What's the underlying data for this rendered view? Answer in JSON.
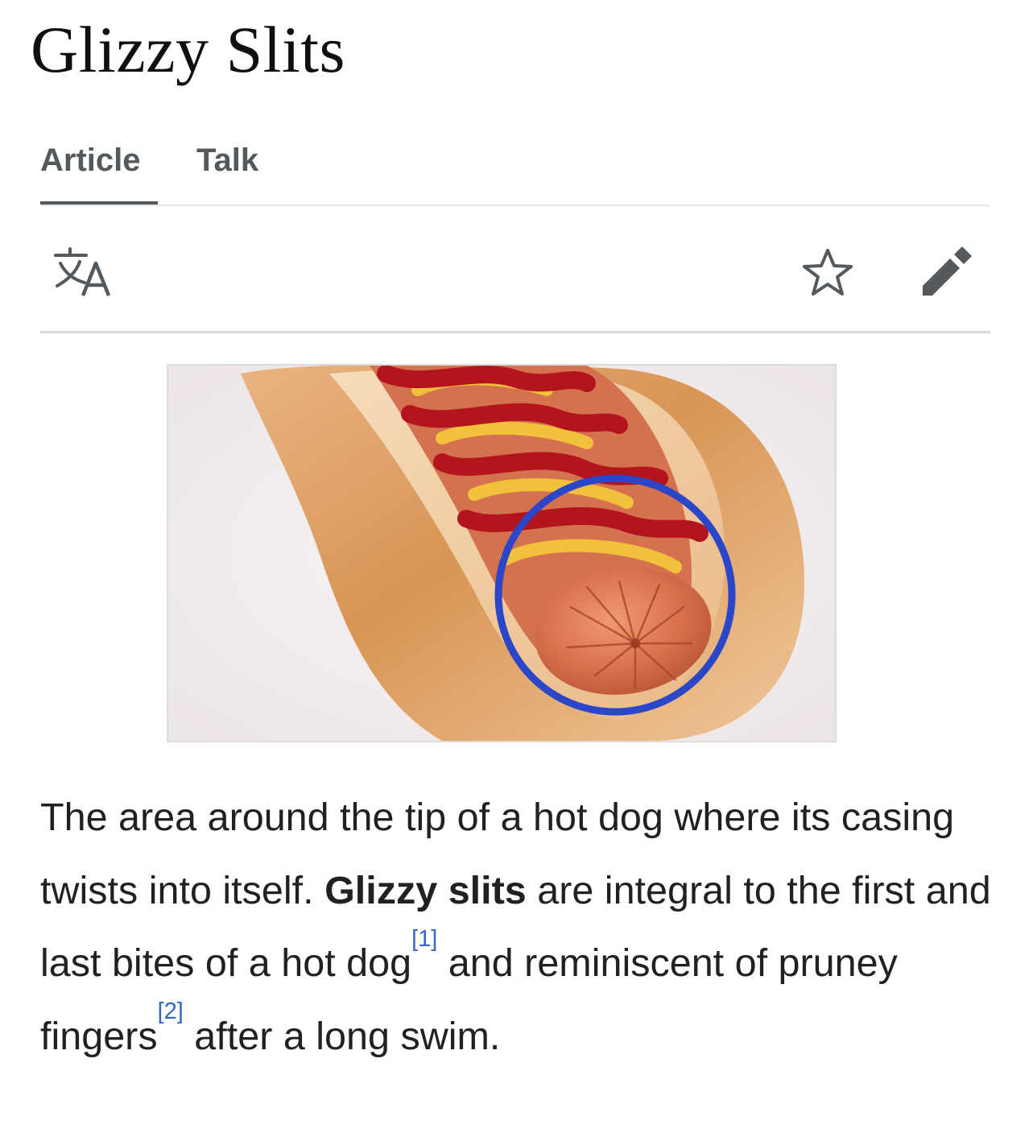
{
  "article": {
    "title": "Glizzy Slits"
  },
  "tabs": [
    {
      "label": "Article",
      "selected": true
    },
    {
      "label": "Talk",
      "selected": false
    }
  ],
  "toolbar": {
    "language_icon": "translate-icon",
    "watch_icon": "star-icon",
    "edit_icon": "pencil-icon"
  },
  "figure": {
    "description_icon": "hot-dog-photo",
    "highlight_color": "#2b46c9"
  },
  "content": {
    "part1": "The area around the tip of a hot dog where its casing twists into itself. ",
    "bold_term": "Glizzy slits",
    "part2": " are integral to the first and last bites of a hot dog",
    "ref1": "[1]",
    "part3": " and reminiscent of pruney fingers",
    "ref2": "[2]",
    "part4": " after a long swim."
  },
  "colors": {
    "text": "#202122",
    "tab_text": "#54595d",
    "link": "#3366cc"
  }
}
